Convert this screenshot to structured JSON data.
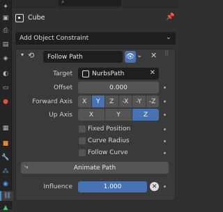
{
  "header": {
    "object_name": "Cube"
  },
  "add_constraint": {
    "label": "Add Object Constraint"
  },
  "constraint": {
    "name": "Follow Path",
    "target_label": "Target",
    "target_value": "NurbsPath",
    "offset_label": "Offset",
    "offset_value": "0.000",
    "forward_axis_label": "Forward Axis",
    "forward_axis_options": [
      "X",
      "Y",
      "Z",
      "-X",
      "-Y",
      "-Z"
    ],
    "forward_axis_selected": "Y",
    "up_axis_label": "Up Axis",
    "up_axis_options": [
      "X",
      "Y",
      "Z"
    ],
    "up_axis_selected": "Z",
    "fixed_position_label": "Fixed Position",
    "curve_radius_label": "Curve Radius",
    "follow_curve_label": "Follow Curve",
    "animate_path_label": "Animate Path",
    "influence_label": "Influence",
    "influence_value": "1.000"
  },
  "colors": {
    "accent": "#4772b3",
    "panel": "#3a3a3a",
    "background": "#303030",
    "field": "#545454"
  }
}
